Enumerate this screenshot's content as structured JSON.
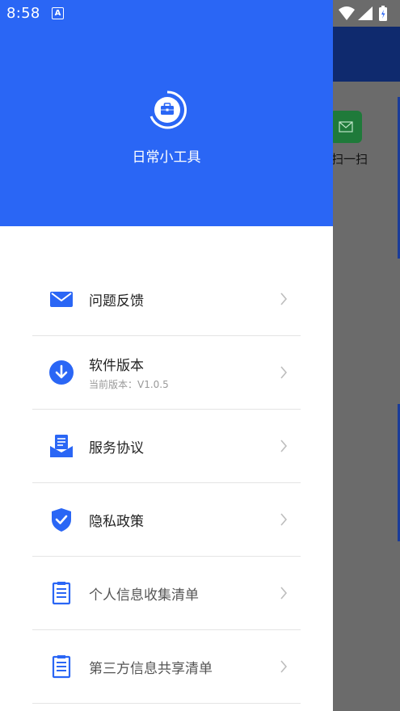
{
  "status_bar": {
    "time": "8:58",
    "notification_letter": "A"
  },
  "drawer": {
    "app_name": "日常小工具",
    "colors": {
      "header": "#2a66f5",
      "icon_blue": "#2a66f5"
    },
    "menu": [
      {
        "label": "问题反馈",
        "icon": "mail-icon"
      },
      {
        "label": "软件版本",
        "subtitle": "当前版本：V1.0.5",
        "icon": "download-icon"
      },
      {
        "label": "服务协议",
        "icon": "agreement-icon"
      },
      {
        "label": "隐私政策",
        "icon": "shield-icon"
      },
      {
        "label": "个人信息收集清单",
        "icon": "list-icon"
      },
      {
        "label": "第三方信息共享清单",
        "icon": "list-icon"
      }
    ]
  },
  "background_app": {
    "tile_label": "扫一扫"
  }
}
